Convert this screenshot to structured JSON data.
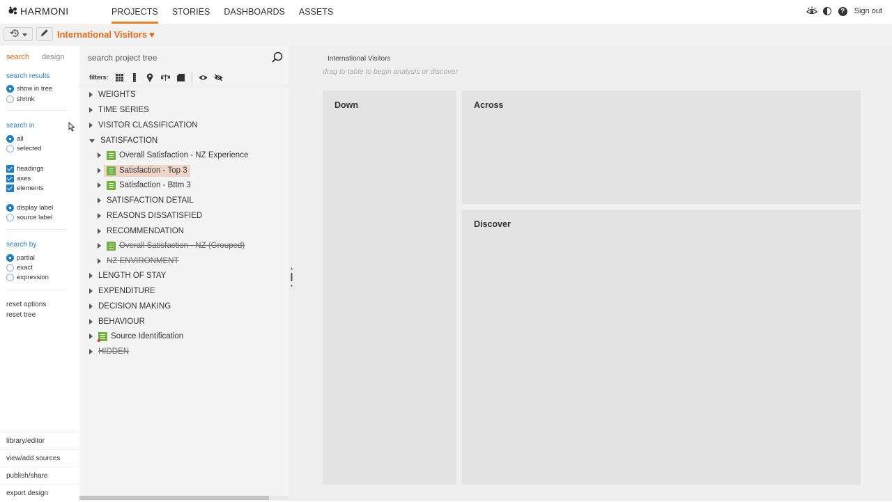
{
  "app": {
    "logo_text": "HARMONI"
  },
  "nav": {
    "items": [
      "PROJECTS",
      "STORIES",
      "DASHBOARDS",
      "ASSETS"
    ],
    "active": "PROJECTS"
  },
  "topbar": {
    "sign_out": "Sign out",
    "icons": [
      "eye-icon",
      "contrast-icon",
      "help-icon"
    ]
  },
  "toolbar": {
    "project_title": "International Visitors",
    "heart": "♥"
  },
  "left_panel": {
    "tabs": {
      "search": "search",
      "design": "design"
    },
    "search_results": {
      "heading": "search results",
      "options": [
        "show in tree",
        "shrink"
      ],
      "selected": "show in tree"
    },
    "search_in": {
      "heading": "search in",
      "options": [
        "all",
        "selected"
      ],
      "selected": "all"
    },
    "checks": [
      "headings",
      "axes",
      "elements"
    ],
    "labels": {
      "options": [
        "display label",
        "source label"
      ],
      "selected": "display label"
    },
    "search_by": {
      "heading": "search by",
      "options": [
        "partial",
        "exact",
        "expression"
      ],
      "selected": "partial"
    },
    "reset_options": "reset options",
    "reset_tree": "reset tree",
    "bottom_links": [
      "library/editor",
      "view/add sources",
      "publish/share",
      "export design"
    ]
  },
  "tree": {
    "search_placeholder": "search project tree",
    "filters_label": "filters:",
    "rows": [
      {
        "label": "WEIGHTS"
      },
      {
        "label": "TIME SERIES"
      },
      {
        "label": "VISITOR CLASSIFICATION"
      },
      {
        "label": "SATISFACTION"
      },
      {
        "label": "Overall Satisfaction - NZ Experience"
      },
      {
        "label": "Satisfaction - Top 3"
      },
      {
        "label": "Satisfaction - Bttm 3"
      },
      {
        "label": "SATISFACTION DETAIL"
      },
      {
        "label": "REASONS DISSATISFIED"
      },
      {
        "label": "RECOMMENDATION"
      },
      {
        "label": "Overall Satisfaction - NZ (Grouped)"
      },
      {
        "label": "NZ ENVIRONMENT"
      },
      {
        "label": "LENGTH OF STAY"
      },
      {
        "label": "EXPENDITURE"
      },
      {
        "label": "DECISION MAKING"
      },
      {
        "label": "BEHAVIOUR"
      },
      {
        "label": "Source Identification"
      },
      {
        "label": "HIDDEN"
      }
    ]
  },
  "workspace": {
    "title": "International Visitors",
    "hint": "drag to table to begin analysis or discover",
    "panels": {
      "down": "Down",
      "across": "Across",
      "discover": "Discover"
    }
  },
  "colors": {
    "accent": "#e8681a",
    "link": "#2a7fc1",
    "check": "#1d7ec6",
    "doc": "#6fb33b",
    "selected_row": "#f0d6c8"
  }
}
